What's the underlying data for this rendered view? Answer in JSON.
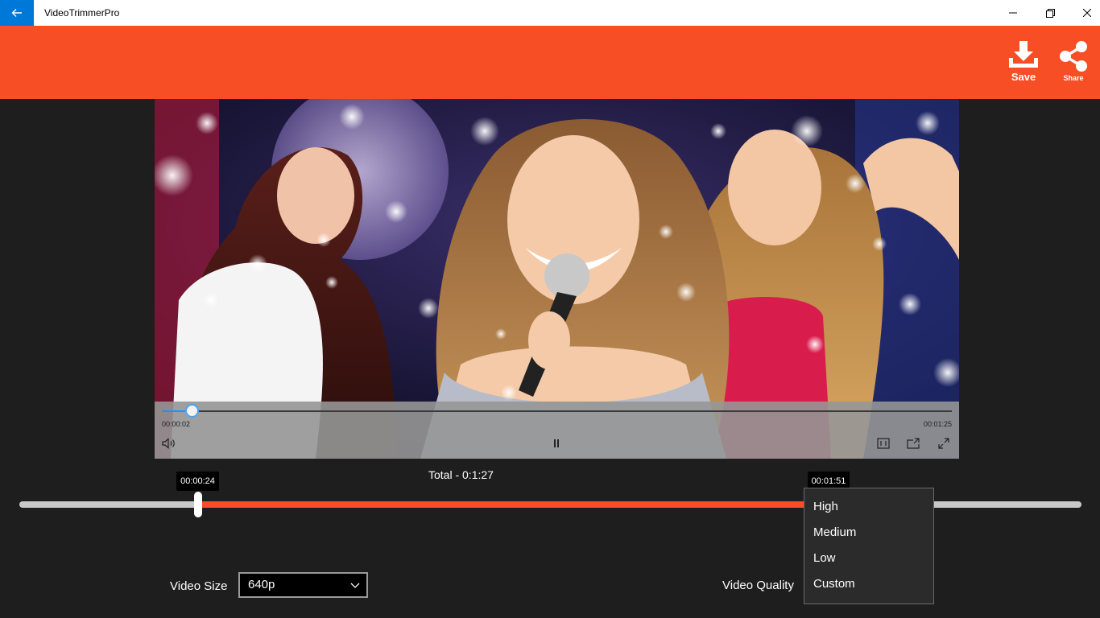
{
  "window": {
    "title": "VideoTrimmerPro"
  },
  "header": {
    "save_label": "Save",
    "share_label": "Share",
    "color": "#f74e26"
  },
  "player": {
    "current_time": "00:00:02",
    "duration": "00:01:25",
    "progress": 0.038
  },
  "trim": {
    "total_label": "Total - 0:1:27",
    "start_label": "00:00:24",
    "end_label": "00:01:51",
    "start_fraction": 0.168,
    "end_fraction": 0.762
  },
  "options": {
    "size_label": "Video Size",
    "size_value": "640p",
    "quality_label": "Video Quality"
  },
  "quality_menu": {
    "items": [
      "High",
      "Medium",
      "Low",
      "Custom"
    ]
  },
  "icons": {
    "back": "back-arrow-icon",
    "minimize": "minimize-icon",
    "restore": "restore-icon",
    "close": "close-icon",
    "save": "download-icon",
    "share": "share-icon",
    "volume": "volume-icon",
    "pause": "pause-icon",
    "aspect": "aspect-ratio-icon",
    "cast": "cast-icon",
    "fullscreen": "fullscreen-icon"
  }
}
